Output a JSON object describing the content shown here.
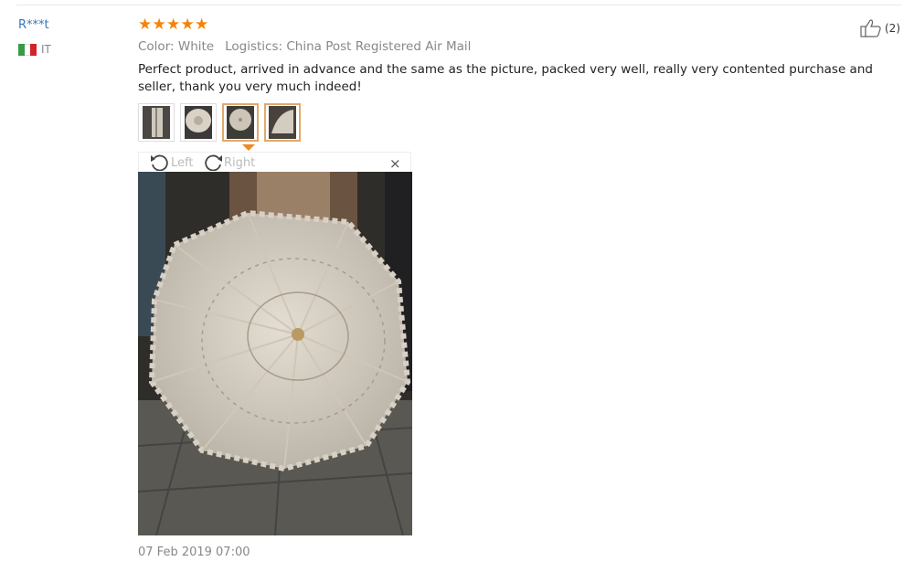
{
  "reviewer": {
    "name": "R***t",
    "country": "IT",
    "flag_colors": [
      "#3a9a45",
      "#ffffff",
      "#d2232a"
    ]
  },
  "rating": {
    "value": 5,
    "max": 5,
    "star_glyph": "★",
    "color": "#f5820b"
  },
  "helpful": {
    "icon": "thumbs-up-icon",
    "count": "(2)"
  },
  "meta": {
    "color": "Color: White",
    "logistics": "Logistics: China Post Registered Air Mail"
  },
  "review_text": "Perfect product, arrived in advance and the same as the picture, packed very well, really very contented purchase and seller, thank you very much indeed!",
  "thumbnails": [
    {
      "name": "photo-thumbnail-1",
      "selected": false
    },
    {
      "name": "photo-thumbnail-2",
      "selected": false
    },
    {
      "name": "photo-thumbnail-3",
      "selected": true
    },
    {
      "name": "photo-thumbnail-4",
      "selected": false
    }
  ],
  "viewer": {
    "rotate_left": "Left",
    "rotate_right": "Right",
    "close_glyph": "×",
    "image_subject": "white lace parasol umbrella photo"
  },
  "date": "07 Feb 2019 07:00"
}
